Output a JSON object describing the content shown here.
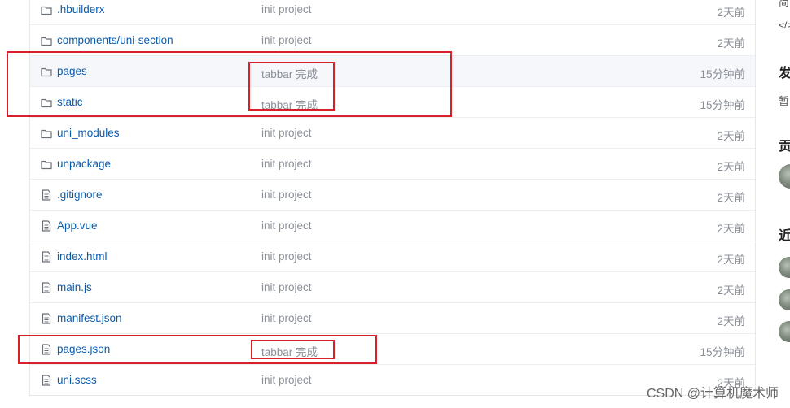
{
  "files": [
    {
      "name": ".hbuilderx",
      "type": "folder",
      "message": "init project",
      "time": "2天前"
    },
    {
      "name": "components/uni-section",
      "type": "folder",
      "message": "init project",
      "time": "2天前"
    },
    {
      "name": "pages",
      "type": "folder",
      "message": "tabbar 完成",
      "time": "15分钟前"
    },
    {
      "name": "static",
      "type": "folder",
      "message": "tabbar 完成",
      "time": "15分钟前"
    },
    {
      "name": "uni_modules",
      "type": "folder",
      "message": "init project",
      "time": "2天前"
    },
    {
      "name": "unpackage",
      "type": "folder",
      "message": "init project",
      "time": "2天前"
    },
    {
      "name": ".gitignore",
      "type": "file",
      "message": "init project",
      "time": "2天前"
    },
    {
      "name": "App.vue",
      "type": "file",
      "message": "init project",
      "time": "2天前"
    },
    {
      "name": "index.html",
      "type": "file",
      "message": "init project",
      "time": "2天前"
    },
    {
      "name": "main.js",
      "type": "file",
      "message": "init project",
      "time": "2天前"
    },
    {
      "name": "manifest.json",
      "type": "file",
      "message": "init project",
      "time": "2天前"
    },
    {
      "name": "pages.json",
      "type": "file",
      "message": "tabbar 完成",
      "time": "15分钟前"
    },
    {
      "name": "uni.scss",
      "type": "file",
      "message": "init project",
      "time": "2天前"
    }
  ],
  "sidebar": {
    "top_partial": "简",
    "code_icon_text": "</>",
    "release_heading": "发",
    "release_text": "暂",
    "contrib_heading": "贡",
    "recent_heading": "近"
  },
  "watermark": "CSDN @计算机魔术师",
  "colors": {
    "link": "#0b5cad",
    "muted": "#8a8f98",
    "annotation": "#d9202a"
  }
}
